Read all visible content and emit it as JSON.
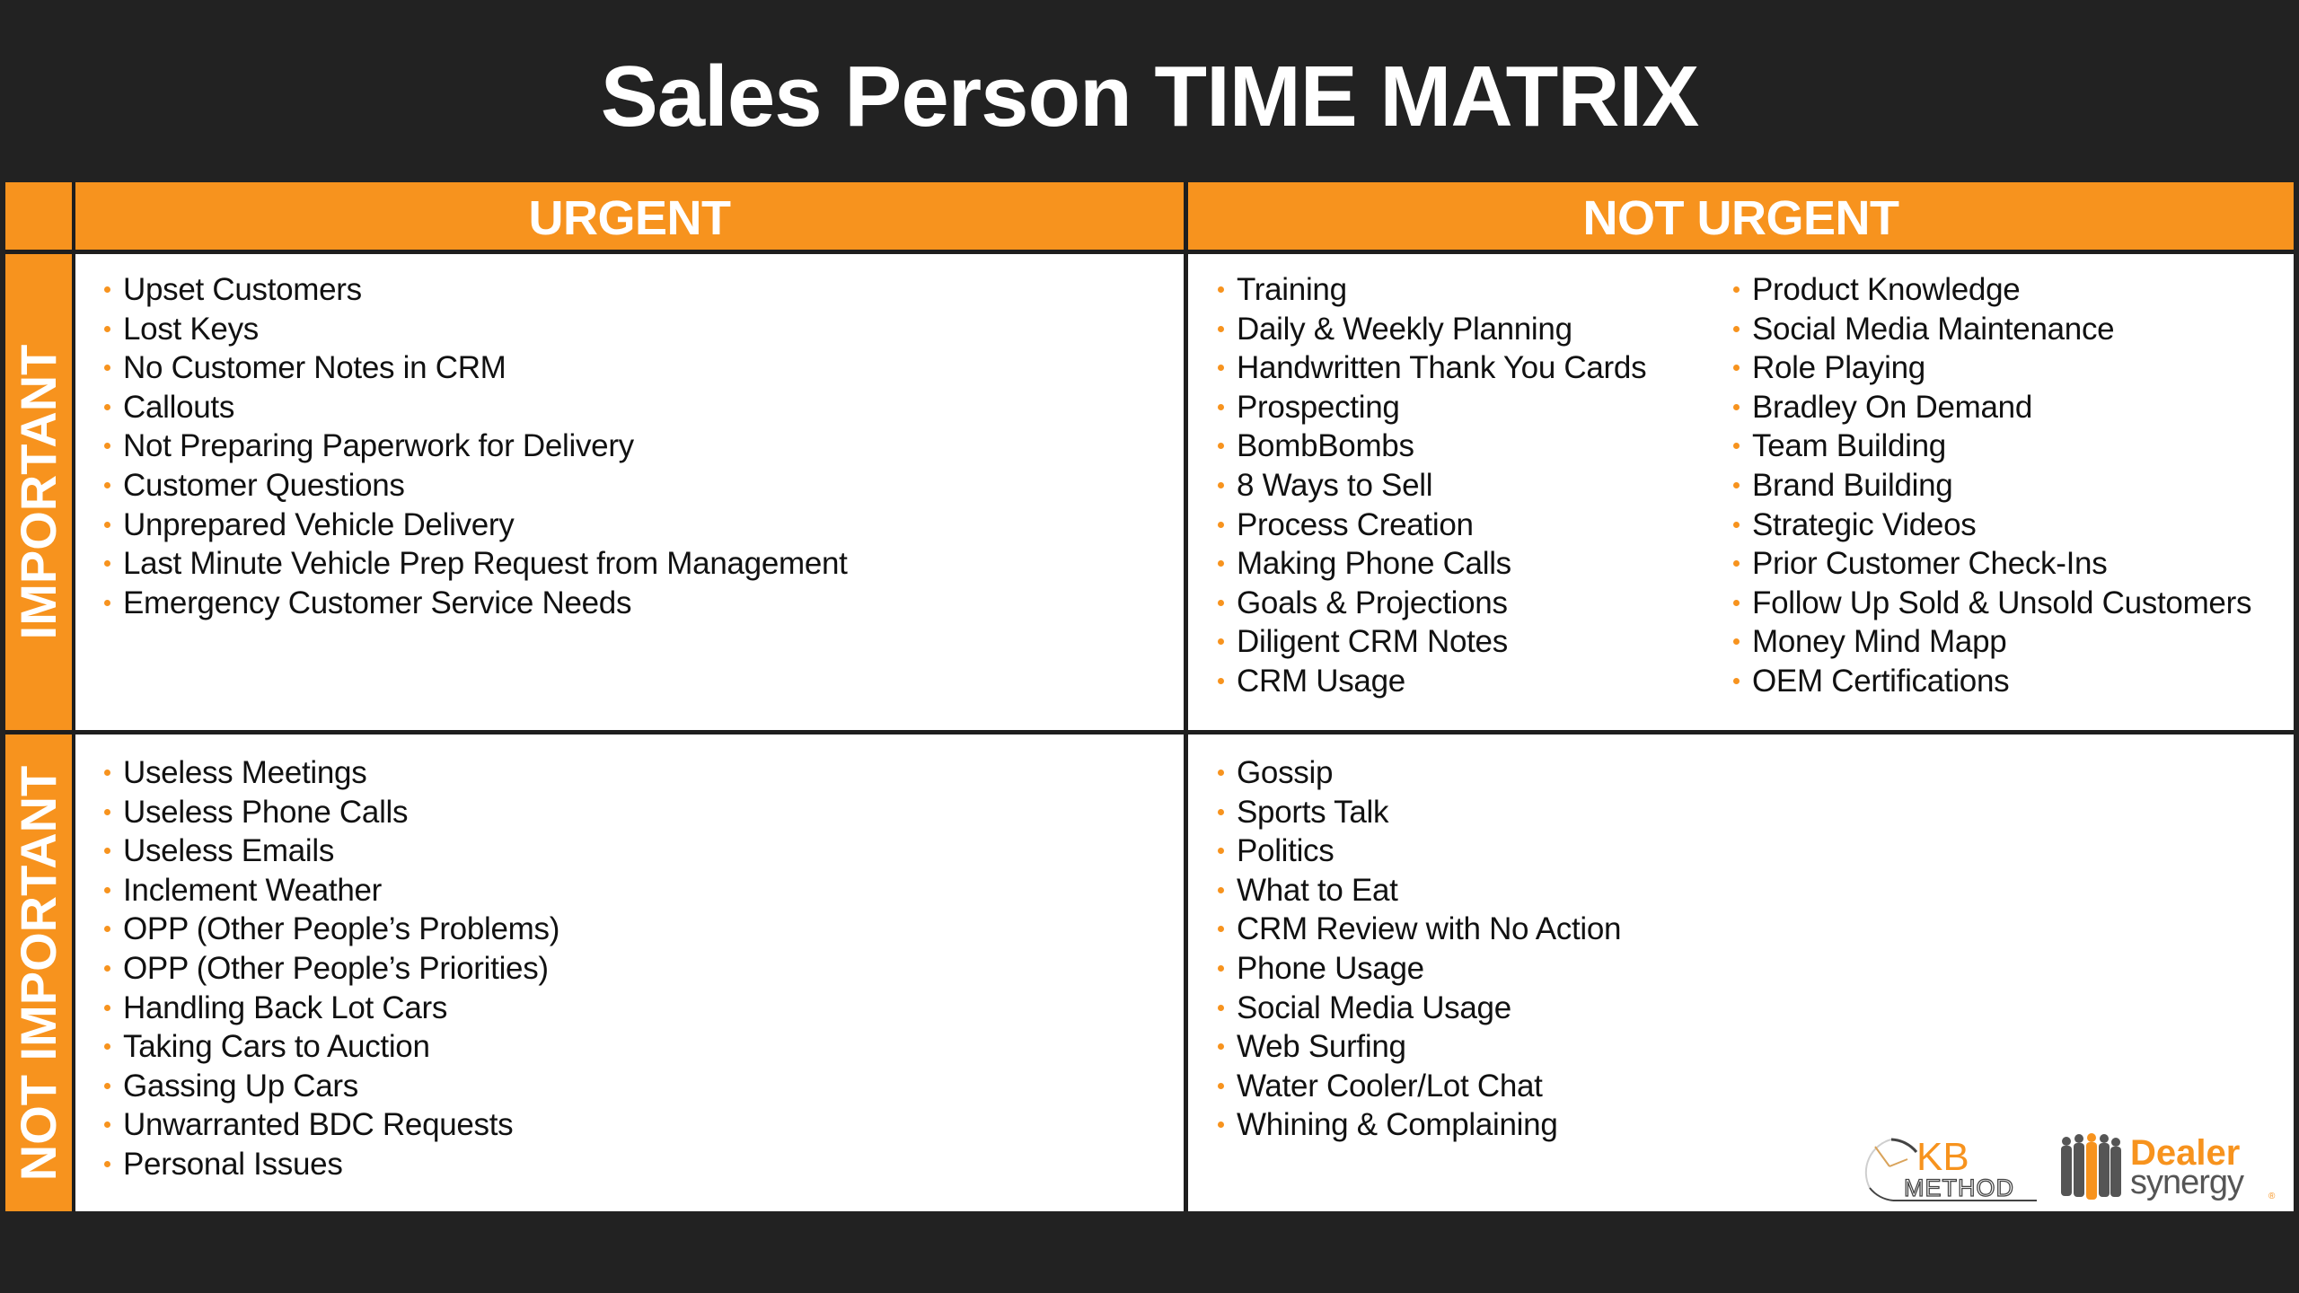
{
  "title": "Sales Person TIME MATRIX",
  "colors": {
    "background": "#222222",
    "accent": "#F7931E",
    "panel": "#FFFFFF",
    "text": "#111111"
  },
  "headers": {
    "urgent": "URGENT",
    "not_urgent": "NOT URGENT",
    "important": "IMPORTANT",
    "not_important": "NOT IMPORTANT"
  },
  "quadrants": {
    "urgent_important": {
      "items": [
        "Upset Customers",
        "Lost Keys",
        "No Customer Notes in CRM",
        "Callouts",
        "Not Preparing Paperwork for Delivery",
        "Customer Questions",
        "Unprepared Vehicle Delivery",
        "Last Minute Vehicle Prep Request from Management",
        "Emergency Customer Service Needs"
      ]
    },
    "not_urgent_important": {
      "column1": [
        "Training",
        "Daily & Weekly Planning",
        "Handwritten Thank You Cards",
        "Prospecting",
        "BombBombs",
        "8 Ways to Sell",
        "Process Creation",
        "Making Phone Calls",
        "Goals & Projections",
        "Diligent CRM Notes",
        "CRM Usage"
      ],
      "column2": [
        "Product Knowledge",
        "Social Media Maintenance",
        "Role Playing",
        "Bradley On Demand",
        "Team Building",
        "Brand Building",
        "Strategic Videos",
        "Prior Customer Check-Ins",
        "Follow Up Sold & Unsold Customers",
        "Money Mind Mapp",
        "OEM Certifications"
      ]
    },
    "urgent_not_important": {
      "items": [
        "Useless Meetings",
        "Useless Phone Calls",
        "Useless Emails",
        "Inclement Weather",
        "OPP (Other People’s Problems)",
        "OPP (Other People’s Priorities)",
        "Handling Back Lot Cars",
        "Taking Cars to Auction",
        "Gassing Up Cars",
        "Unwarranted BDC Requests",
        "Personal Issues"
      ]
    },
    "not_urgent_not_important": {
      "items": [
        "Gossip",
        "Sports Talk",
        "Politics",
        "What to Eat",
        "CRM Review with No Action",
        "Phone Usage",
        "Social Media Usage",
        "Web Surfing",
        "Water Cooler/Lot Chat",
        "Whining & Complaining"
      ]
    }
  },
  "logos": {
    "kb_method": {
      "line1": "KB",
      "line2": "METHOD",
      "icon": "clock-icon"
    },
    "dealer_synergy": {
      "line1": "Dealer",
      "line2": "synergy",
      "mark": "®",
      "icon": "people-silhouettes-icon"
    }
  }
}
